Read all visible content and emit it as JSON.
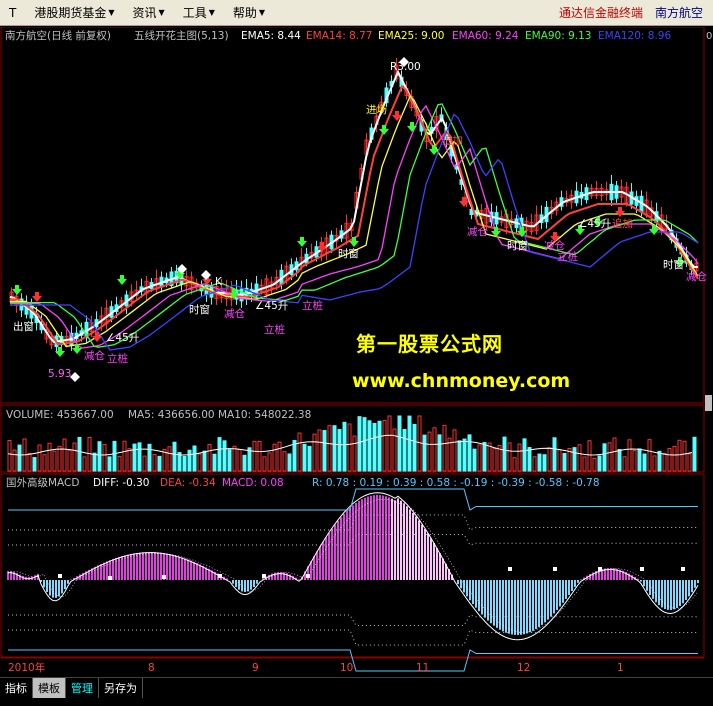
{
  "menu": {
    "items": [
      "T",
      "港股期货基金",
      "资讯",
      "工具",
      "帮助"
    ],
    "brand": "通达信金融终端",
    "stock": "南方航空"
  },
  "main_panel": {
    "header": {
      "stock": "南方航空(日线 前复权)",
      "indicator": "五线开花主图(5,13)",
      "ema5": "EMA5: 8.44",
      "ema14": "EMA14: 8.77",
      "ema25": "EMA25: 9.00",
      "ema60": "EMA60: 9.24",
      "ema90": "EMA90: 9.13",
      "ema120": "EMA120: 8.96"
    },
    "annotations": {
      "peak": "R3.00",
      "low": "5.93",
      "jinjin": "进场",
      "zhuijia": "追加",
      "shichuang": "时窗",
      "jianyu": "减仓",
      "lizhuang": "立桩",
      "jiaoduan": "∠45升",
      "chuchang": "出窗",
      "k": "K"
    },
    "right_axis_marker": "0"
  },
  "volume_panel": {
    "header": {
      "volume": "VOLUME: 453667.00",
      "ma5": "MA5: 436656.00",
      "ma10": "MA10: 548022.38"
    }
  },
  "macd_panel": {
    "header": {
      "name": "国外高级MACD",
      "diff": "DIFF: -0.30",
      "dea": "DEA: -0.34",
      "macd": "MACD: 0.08",
      "r": "R: 0.78 : 0.19 : 0.39 : 0.58 : -0.19 : -0.39 : -0.58 : -0.78"
    }
  },
  "time_axis": {
    "labels": [
      "2010年",
      "8",
      "9",
      "10",
      "11",
      "12",
      "1"
    ]
  },
  "watermark": {
    "title": "第一股票公式网",
    "url": "www.chnmoney.com"
  },
  "tabs": [
    "指标",
    "模板",
    "管理",
    "另存为"
  ],
  "colors": {
    "up": "#ff3030",
    "down": "#54ffff",
    "ema5": "#ffffff",
    "ema14": "#ff4040",
    "ema25": "#ffff40",
    "ema60": "#ff40ff",
    "ema90": "#40ff40",
    "ema120": "#4040ff"
  }
}
